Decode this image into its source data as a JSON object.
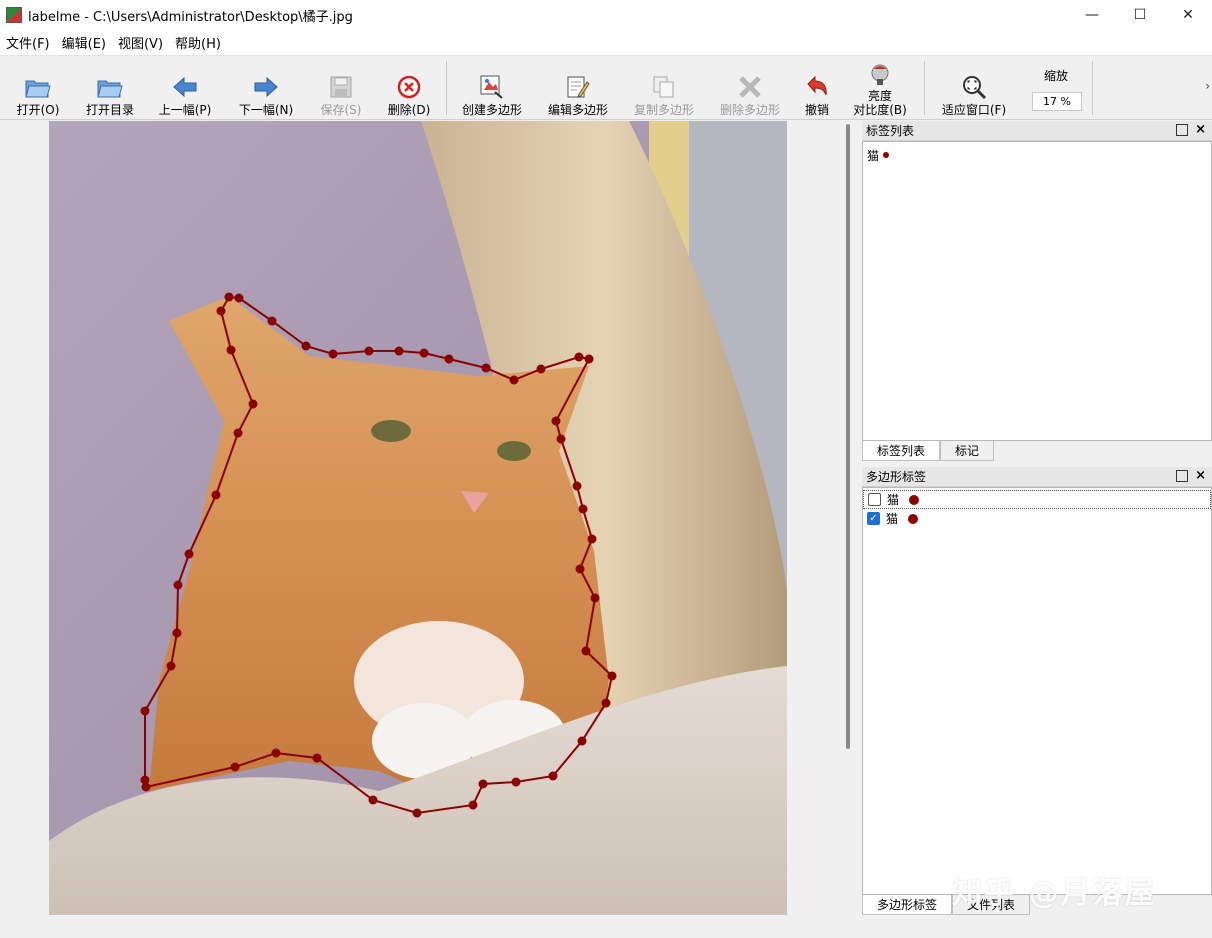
{
  "window": {
    "title": "labelme - C:\\Users\\Administrator\\Desktop\\橘子.jpg",
    "minimize": "—",
    "maximize": "☐",
    "close": "✕"
  },
  "menu": [
    "文件(F)",
    "编辑(E)",
    "视图(V)",
    "帮助(H)"
  ],
  "toolbar": {
    "open": "打开(O)",
    "open_dir": "打开目录",
    "prev": "上一幅(P)",
    "next": "下一幅(N)",
    "save": "保存(S)",
    "delete": "删除(D)",
    "create_polygon": "创建多边形",
    "edit_polygon": "编辑多边形",
    "copy_polygon": "复制多边形",
    "delete_polygon": "删除多边形",
    "undo": "撤销",
    "brightness_line1": "亮度",
    "brightness_line2": "对比度(B)",
    "fit_window": "适应窗口(F)",
    "zoom_label": "缩放",
    "zoom_value": "17 %",
    "more": "›"
  },
  "label_list_dock": {
    "title": "标签列表",
    "items": [
      {
        "text": "猫",
        "color": "#8b0000"
      }
    ],
    "tabs": [
      "标签列表",
      "标记"
    ]
  },
  "polygon_dock": {
    "title": "多边形标签",
    "items": [
      {
        "text": "猫",
        "checked": false,
        "color": "#8b0000"
      },
      {
        "text": "猫",
        "checked": true,
        "color": "#8b0000"
      }
    ],
    "tabs": [
      "多边形标签",
      "文件列表"
    ]
  },
  "watermark": "知乎 @月落屋",
  "colors": {
    "polygon": "#8b0000",
    "checkbox_checked": "#1e6fd2"
  },
  "icons": {
    "open": "folder-open-icon",
    "open_dir": "folder-open-icon",
    "prev": "arrow-left-icon",
    "next": "arrow-right-icon",
    "save": "save-icon",
    "delete": "delete-circle-icon",
    "create_polygon": "create-polygon-icon",
    "edit_polygon": "edit-polygon-icon",
    "copy_polygon": "copy-polygon-icon",
    "delete_polygon": "delete-polygon-icon",
    "undo": "undo-icon",
    "brightness": "brightness-contrast-icon",
    "fit_window": "fit-window-icon"
  }
}
